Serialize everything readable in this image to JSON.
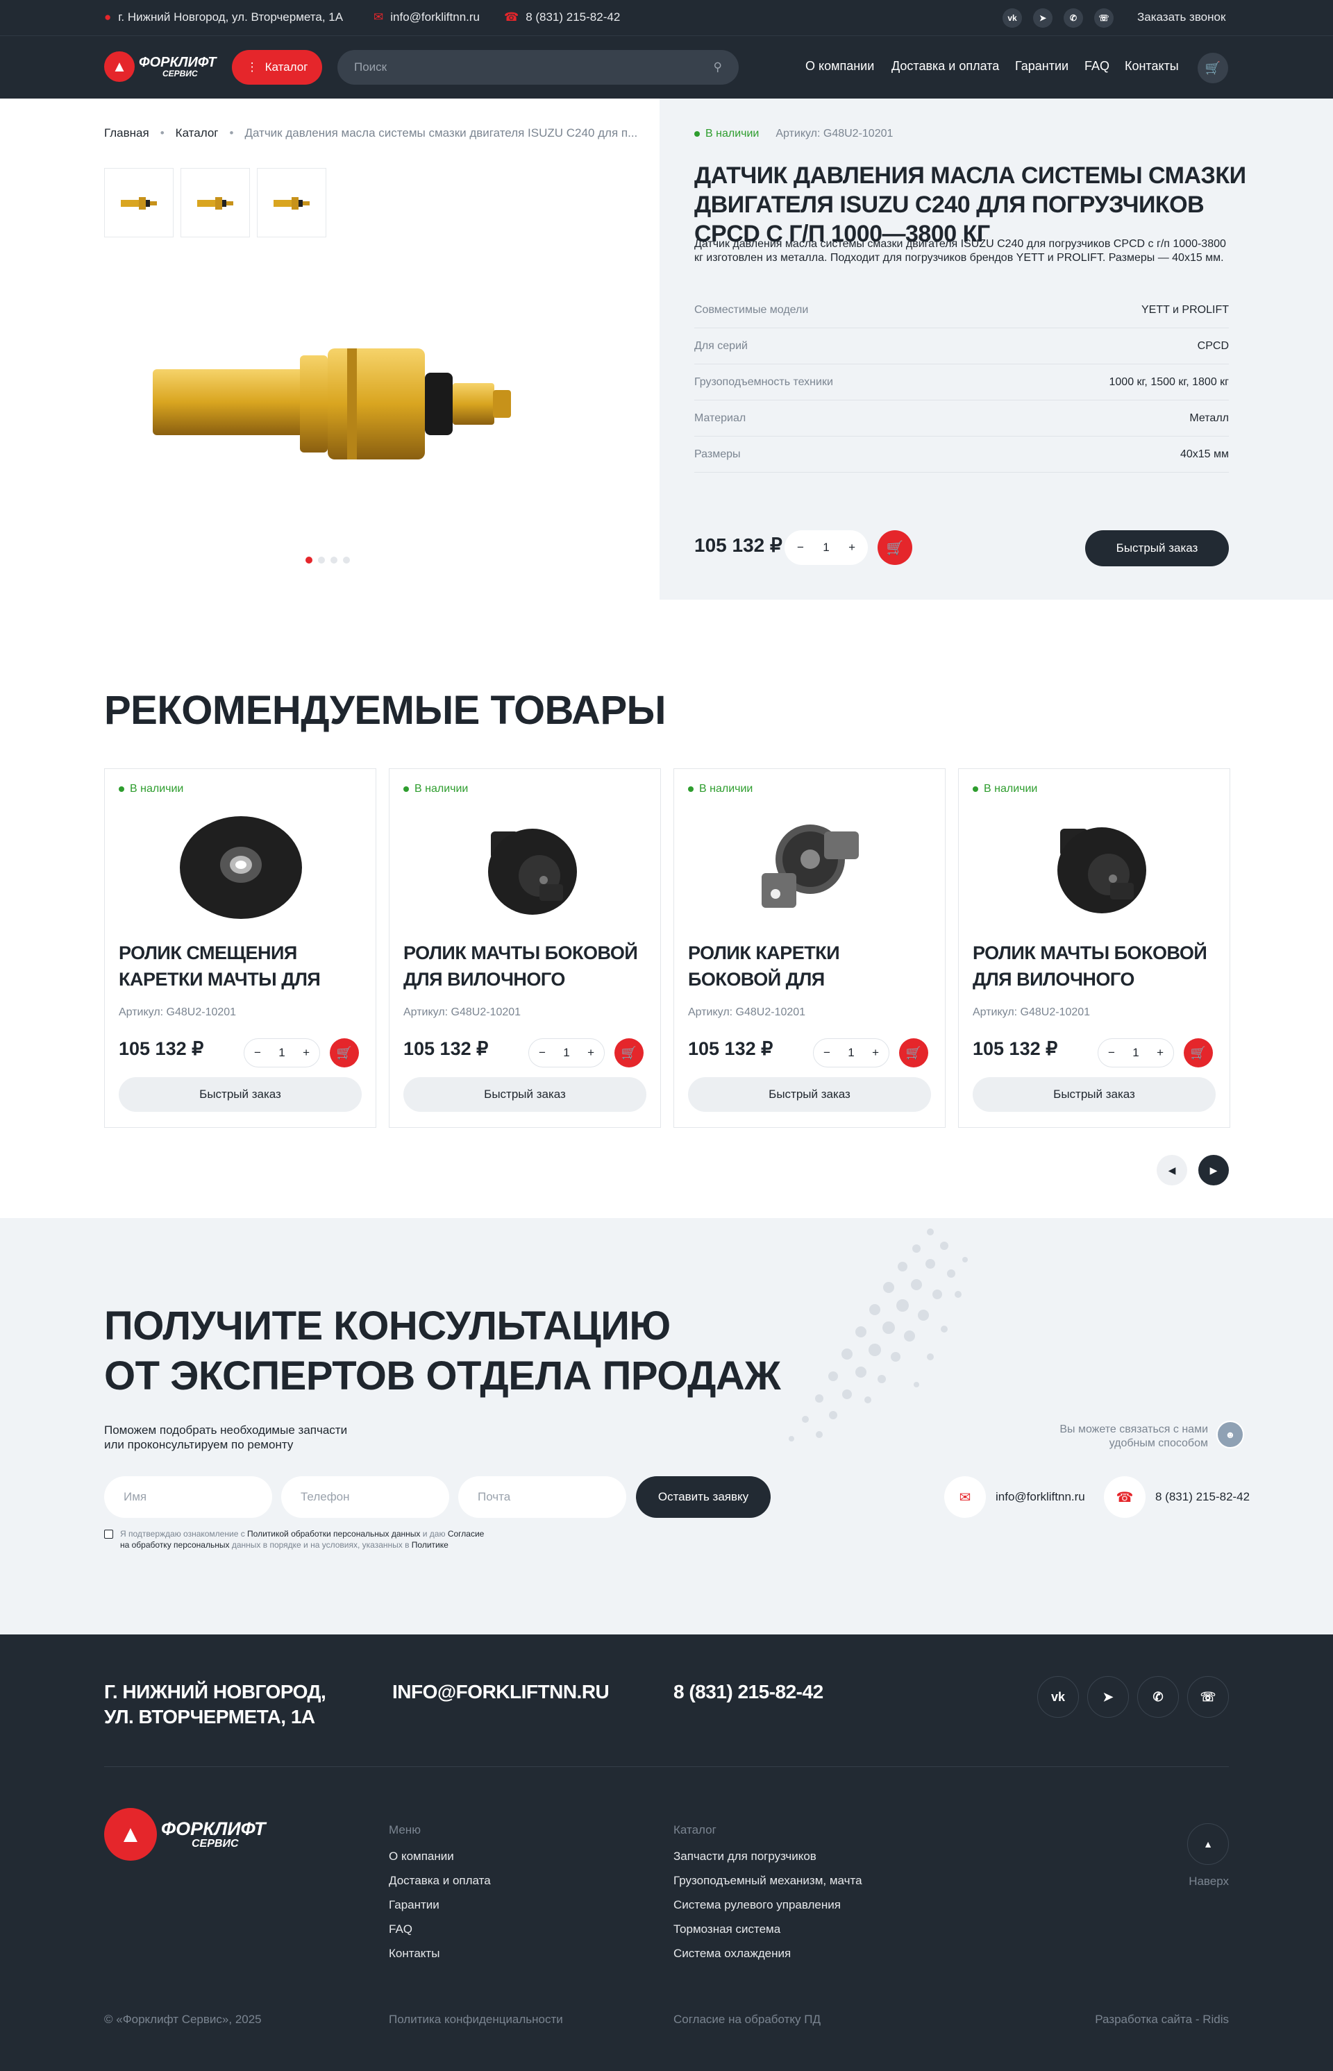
{
  "topbar": {
    "address": "г. Нижний Новгород, ул. Вторчермета, 1А",
    "email": "info@forkliftnn.ru",
    "phone": "8 (831) 215-82-42",
    "socials": [
      "vk",
      "tg",
      "wa",
      "vb"
    ],
    "callback": "Заказать звонок"
  },
  "header": {
    "logo_top": "ФОРКЛИФТ",
    "logo_bottom": "СЕРВИС",
    "catalog": "Каталог",
    "search_placeholder": "Поиск",
    "nav": [
      "О компании",
      "Доставка и оплата",
      "Гарантии",
      "FAQ",
      "Контакты"
    ]
  },
  "breadcrumb": [
    "Главная",
    "Каталог",
    "Датчик давления масла системы смазки двигателя ISUZU C240 для п..."
  ],
  "product": {
    "stock": "В наличии",
    "sku": "Артикул: G48U2-10201",
    "title": "Датчик давления масла системы смазки двигателя ISUZU C240 для погрузчиков CPCD с г/п 1000—3800 кг",
    "description": "Датчик давления масла системы смазки двигателя ISUZU C240 для погрузчиков CPCD с г/п 1000-3800 кг изготовлен из металла. Подходит для погрузчиков брендов YETT и PROLIFT. Размеры — 40х15 мм.",
    "specs": [
      {
        "k": "Совместимые модели",
        "v": "YETT и PROLIFT"
      },
      {
        "k": "Для серий",
        "v": "CPCD"
      },
      {
        "k": "Грузоподъемность техники",
        "v": "1000 кг, 1500 кг, 1800 кг"
      },
      {
        "k": "Материал",
        "v": "Металл"
      },
      {
        "k": "Размеры",
        "v": "40х15 мм"
      }
    ],
    "price": "105 132 ₽",
    "qty": "1",
    "quick": "Быстрый заказ",
    "slides": 4
  },
  "recommended": {
    "title": "Рекомендуемые товары",
    "items": [
      {
        "stock": "В наличии",
        "name": "Ролик смещения каретки мачты для вилочного погруз...",
        "art": "Артикул: G48U2-10201",
        "price": "105 132 ₽",
        "qty": "1",
        "quick": "Быстрый заказ"
      },
      {
        "stock": "В наличии",
        "name": "Ролик мачты боковой для вилочного погрузчика CPD и C...",
        "art": "Артикул: G48U2-10201",
        "price": "105 132 ₽",
        "qty": "1",
        "quick": "Быстрый заказ"
      },
      {
        "stock": "В наличии",
        "name": "Ролик каретки боковой для вилочного погрузчика CPD",
        "art": "Артикул: G48U2-10201",
        "price": "105 132 ₽",
        "qty": "1",
        "quick": "Быстрый заказ"
      },
      {
        "stock": "В наличии",
        "name": "Ролик мачты боковой для вилочного погрузчика CPD и C...",
        "art": "Артикул: G48U2-10201",
        "price": "105 132 ₽",
        "qty": "1",
        "quick": "Быстрый заказ"
      }
    ]
  },
  "consult": {
    "title_line1": "Получите консультацию",
    "title_line2": "от экспертов отдела продаж",
    "subtitle_line1": "Поможем подобрать необходимые запчасти",
    "subtitle_line2": "или проконсультируем по ремонту",
    "name_placeholder": "Имя",
    "phone_placeholder": "Телефон",
    "email_placeholder": "Почта",
    "submit": "Оставить заявку",
    "agree_1": "Я подтверждаю ознакомление с",
    "agree_2": "Политикой обработки персональных данных",
    "agree_3": "и даю",
    "agree_4": "Согласие",
    "agree_5": "на обработку персональных",
    "agree_6": "данных в порядке и на условиях, указанных в",
    "agree_7": "Политике",
    "contact_note_line1": "Вы можете связаться с нами",
    "contact_note_line2": "удобным способом",
    "email": "info@forkliftnn.ru",
    "phone": "8 (831) 215-82-42"
  },
  "footer": {
    "address_line1": "г. Нижний Новгород,",
    "address_line2": "ул. Вторчермета, 1А",
    "email": "info@forkliftnn.ru",
    "phone": "8 (831) 215-82-42",
    "menu_title": "Меню",
    "menu": [
      "О компании",
      "Доставка и оплата",
      "Гарантии",
      "FAQ",
      "Контакты"
    ],
    "catalog_title": "Каталог",
    "catalog": [
      "Запчасти для погрузчиков",
      "Грузоподъемный механизм, мачта",
      "Система рулевого управления",
      "Тормозная система",
      "Система охлаждения"
    ],
    "up": "Наверх",
    "copyright": "© «Форклифт Сервис», 2025",
    "privacy": "Политика конфиденциальности",
    "consent": "Согласие на обработку ПД",
    "dev": "Разработка сайта - Ridis"
  },
  "colors": {
    "accent": "#e5262b",
    "dark": "#222a33",
    "light": "#f0f3f6",
    "stock": "#2e9d2e"
  }
}
